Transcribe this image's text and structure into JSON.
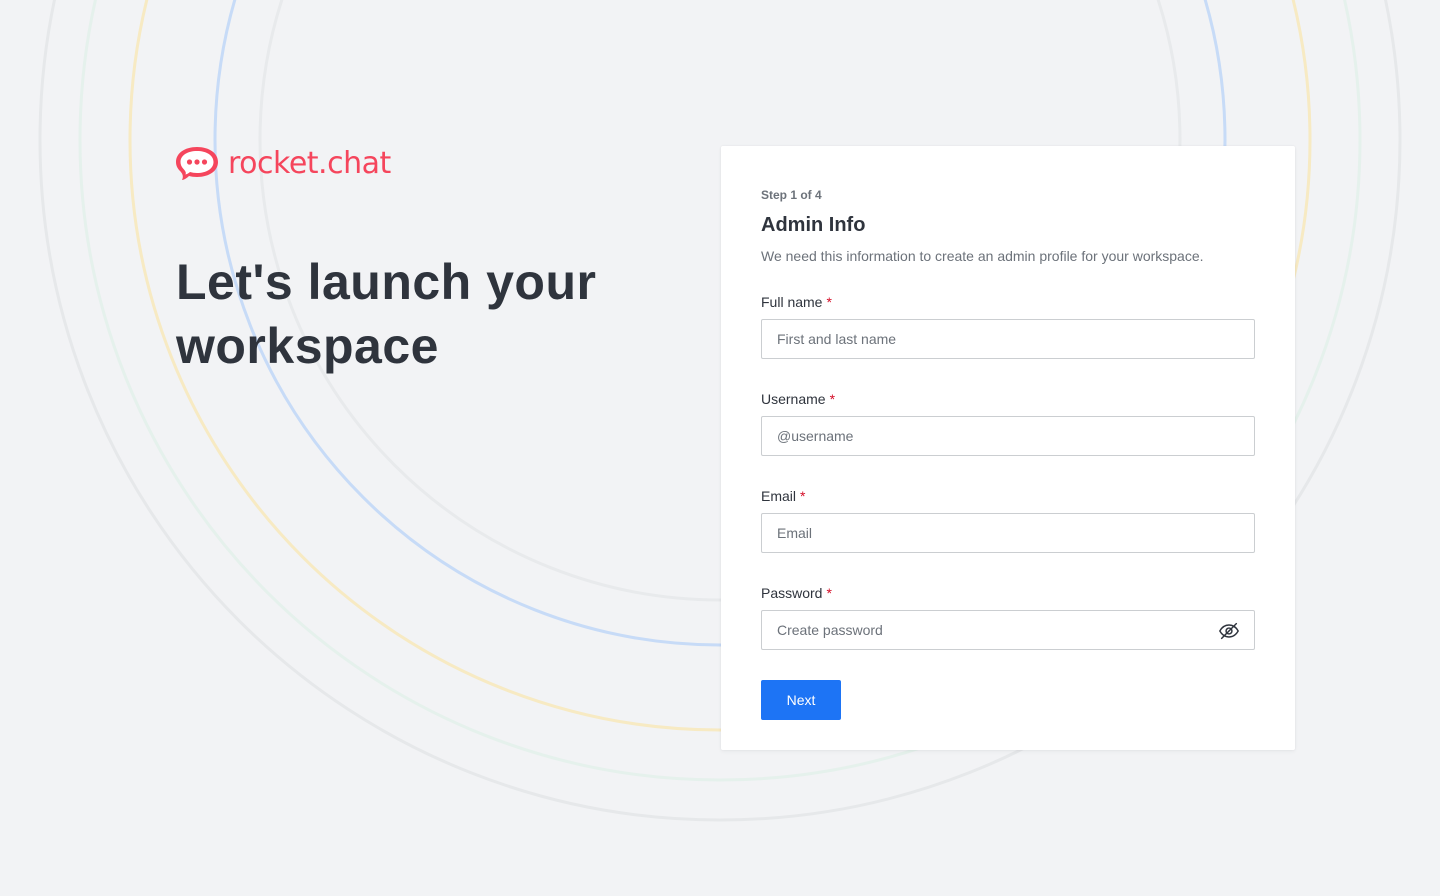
{
  "brand": {
    "logo_text": "rocket.chat",
    "logo_icon": "rocket-chat-bubble-icon",
    "color": "#f5455c"
  },
  "hero": {
    "headline": "Let's launch your workspace"
  },
  "form": {
    "step": "Step 1 of 4",
    "title": "Admin Info",
    "subtitle": "We need this information to create an admin profile for your workspace.",
    "required_mark": "*",
    "fields": [
      {
        "label": "Full name",
        "placeholder": "First and last name",
        "value": ""
      },
      {
        "label": "Username",
        "placeholder": "@username",
        "value": ""
      },
      {
        "label": "Email",
        "placeholder": "Email",
        "value": ""
      },
      {
        "label": "Password",
        "placeholder": "Create password",
        "value": "",
        "toggle_icon": "eye-off-icon"
      }
    ],
    "next_label": "Next"
  },
  "colors": {
    "primary": "#1d74f5",
    "required": "#d40c26",
    "background": "#f2f3f5"
  }
}
